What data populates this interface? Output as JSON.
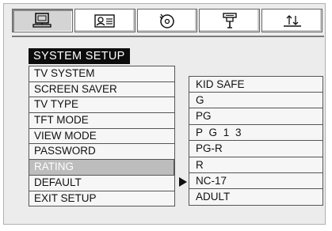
{
  "tabs": [
    {
      "icon": "monitor-icon",
      "active": true
    },
    {
      "icon": "person-card-icon",
      "active": false
    },
    {
      "icon": "disc-audio-icon",
      "active": false
    },
    {
      "icon": "speaker-icon",
      "active": false
    },
    {
      "icon": "equalizer-icon",
      "active": false
    }
  ],
  "title": "SYSTEM SETUP",
  "menu": {
    "items": [
      {
        "label": "TV SYSTEM"
      },
      {
        "label": "SCREEN SAVER"
      },
      {
        "label": "TV TYPE"
      },
      {
        "label": "TFT MODE"
      },
      {
        "label": "VIEW MODE"
      },
      {
        "label": "PASSWORD"
      },
      {
        "label": "RATING"
      },
      {
        "label": "DEFAULT"
      },
      {
        "label": "EXIT SETUP"
      }
    ],
    "selected": "RATING"
  },
  "submenu": {
    "items": [
      {
        "label": "KID SAFE"
      },
      {
        "label": "G"
      },
      {
        "label": "PG"
      },
      {
        "label": "P G 1 3"
      },
      {
        "label": "PG-R"
      },
      {
        "label": "R"
      },
      {
        "label": "NC-17"
      },
      {
        "label": "ADULT"
      }
    ]
  },
  "colors": {
    "title_bg": "#0c0c0c",
    "selected_bg": "#bdbdbd",
    "panel_bg": "#ececec"
  }
}
